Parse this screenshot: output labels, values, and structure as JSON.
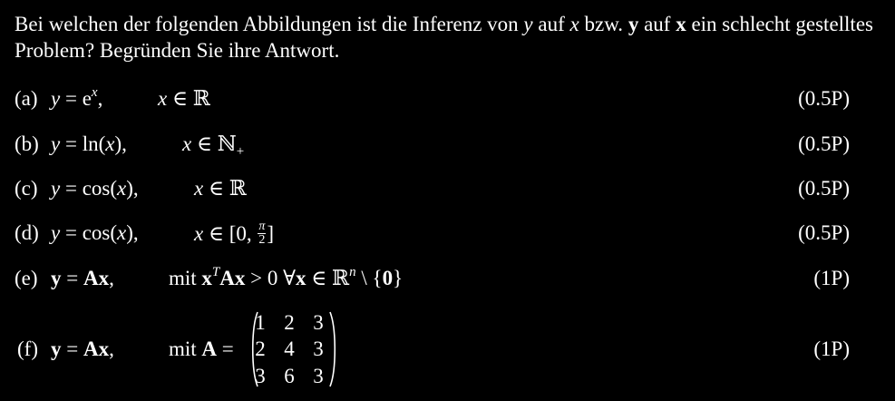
{
  "intro": {
    "t1": "Bei welchen der folgenden Abbildungen ist die Inferenz von ",
    "y": "y",
    "t2": " auf ",
    "x": "x",
    "t3": " bzw. ",
    "yb": "y",
    "t4": " auf ",
    "xb": "x",
    "t5": " ein schlecht gestelltes Problem? Begründen Sie ihre Antwort."
  },
  "items": [
    {
      "label": "(a)",
      "points": "(0.5P)"
    },
    {
      "label": "(b)",
      "points": "(0.5P)"
    },
    {
      "label": "(c)",
      "points": "(0.5P)"
    },
    {
      "label": "(d)",
      "points": "(0.5P)"
    },
    {
      "label": "(e)",
      "points": "(1P)"
    },
    {
      "label": "(f)",
      "points": "(1P)"
    }
  ],
  "a": {
    "y": "y",
    "eq": " = e",
    "exp": "x",
    "comma": ",",
    "x": "x",
    "in": " ∈ ℝ"
  },
  "b": {
    "y": "y",
    "eq": " = ln(",
    "x": "x",
    "close": "),",
    "x2": "x",
    "in": " ∈ ℕ",
    "sub": "+"
  },
  "c": {
    "y": "y",
    "eq": " = cos(",
    "x": "x",
    "close": "),",
    "x2": "x",
    "in": " ∈ ℝ"
  },
  "d": {
    "y": "y",
    "eq": " = cos(",
    "x": "x",
    "close": "),",
    "x2": "x",
    "in": " ∈ [0, ",
    "num": "π",
    "den": "2",
    "end": "]"
  },
  "e": {
    "lhs": "y",
    "eq": " = ",
    "rhs": "Ax",
    "comma": ",",
    "mit": "mit ",
    "xb": "x",
    "T": "T",
    "Ax": "Ax",
    "gt": " > 0  ∀",
    "x2": "x",
    "in": " ∈ ℝ",
    "n": "n",
    "setminus": " \\ {",
    "zero": "0",
    "close": "}"
  },
  "f": {
    "lhs": "y",
    "eq": " = ",
    "rhs": "Ax",
    "comma": ",",
    "mit": "mit ",
    "A": "A",
    "eq2": " ="
  },
  "matrix": [
    [
      "1",
      "2",
      "3"
    ],
    [
      "2",
      "4",
      "3"
    ],
    [
      "3",
      "6",
      "3"
    ]
  ]
}
